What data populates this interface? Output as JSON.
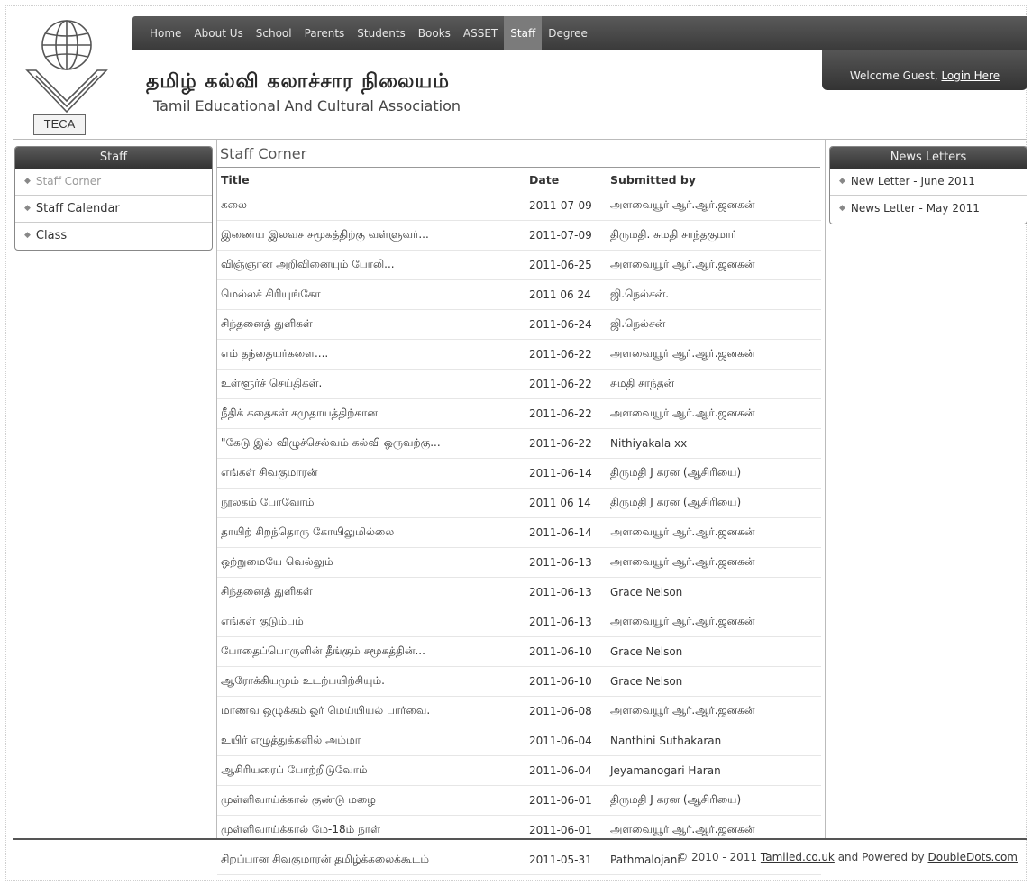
{
  "logo": {
    "text": "TECA",
    "icon": "globe-book-logo-icon"
  },
  "nav": {
    "items": [
      {
        "label": "Home"
      },
      {
        "label": "About Us"
      },
      {
        "label": "School"
      },
      {
        "label": "Parents"
      },
      {
        "label": "Students"
      },
      {
        "label": "Books"
      },
      {
        "label": "ASSET"
      },
      {
        "label": "Staff"
      },
      {
        "label": "Degree"
      }
    ],
    "active": "Staff"
  },
  "welcome": {
    "prefix": "Welcome Guest, ",
    "login": "Login Here"
  },
  "title_tamil": "தமிழ் கல்வி கலாச்சார நிலையம்",
  "title_english": "Tamil Educational And Cultural Association",
  "left_menu": {
    "title": "Staff",
    "items": [
      {
        "label": "Staff Corner"
      },
      {
        "label": "Staff Calendar"
      },
      {
        "label": "Class"
      }
    ]
  },
  "right_menu": {
    "title": "News Letters",
    "items": [
      {
        "label": "New Letter - June 2011"
      },
      {
        "label": "News Letter - May 2011"
      }
    ]
  },
  "content": {
    "heading": "Staff Corner",
    "columns": {
      "title": "Title",
      "date": "Date",
      "submitted": "Submitted by"
    },
    "rows": [
      {
        "title": "கலை",
        "date": "2011-07-09",
        "by": "அளவையூர் ஆர்.ஆர்.ஜனகன்"
      },
      {
        "title": "இணைய இலவச சமூகத்திற்கு வள்ளுவர்...",
        "date": "2011-07-09",
        "by": "திருமதி. சுமதி சாந்தகுமார்"
      },
      {
        "title": "விஞ்ஞான அறிவினையும் போலி...",
        "date": "2011-06-25",
        "by": "அளவையூர் ஆர்.ஆர்.ஜனகன்"
      },
      {
        "title": "மெல்லச் சிரியுங்கோ",
        "date": "2011 06 24",
        "by": "ஜி.நெல்சன்."
      },
      {
        "title": "சிந்தனைத் துளிகள்",
        "date": "2011-06-24",
        "by": "ஜி.நெல்சன்"
      },
      {
        "title": "எம் தந்தையர்களை....",
        "date": "2011-06-22",
        "by": "அளவையூர் ஆர்.ஆர்.ஜனகன்"
      },
      {
        "title": "உள்ளூர்ச் செய்திகள்.",
        "date": "2011-06-22",
        "by": "சுமதி சாந்தன்"
      },
      {
        "title": "நீதிக் கதைகள் சமுதாயத்திற்கான",
        "date": "2011-06-22",
        "by": "அளவையூர் ஆர்.ஆர்.ஜனகன்"
      },
      {
        "title": "\"கேடு இல் விழுச்செல்வம் கல்வி ஒருவற்கு...",
        "date": "2011-06-22",
        "by": "Nithiyakala xx"
      },
      {
        "title": "எங்கள் சிவகுமாரன்",
        "date": "2011-06-14",
        "by": "திருமதி J கரன (ஆசிரியை)"
      },
      {
        "title": "நூலகம் போவோம்",
        "date": "2011 06 14",
        "by": "திருமதி J கரன (ஆசிரியை)"
      },
      {
        "title": "தாயிற் சிறந்தொரு கோயிலுமில்லை",
        "date": "2011-06-14",
        "by": "அளவையூர் ஆர்.ஆர்.ஜனகன்"
      },
      {
        "title": "ஒற்றுமையே வெல்லும்",
        "date": "2011-06-13",
        "by": "அளவையூர் ஆர்.ஆர்.ஜனகன்"
      },
      {
        "title": "சிந்தனைத் துளிகள்",
        "date": "2011-06-13",
        "by": "Grace Nelson"
      },
      {
        "title": "எங்கள் குடும்பம்",
        "date": "2011-06-13",
        "by": "அளவையூர் ஆர்.ஆர்.ஜனகன்"
      },
      {
        "title": "போதைப்பொருளின் தீங்கும் சமூகத்தின்...",
        "date": "2011-06-10",
        "by": "Grace Nelson"
      },
      {
        "title": "ஆரோக்கியமும் உடற்பயிற்சியும்.",
        "date": "2011-06-10",
        "by": "Grace Nelson"
      },
      {
        "title": "மாணவ ஒழுக்கம் ஓர் மெய்யியல் பார்வை.",
        "date": "2011-06-08",
        "by": "அளவையூர் ஆர்.ஆர்.ஜனகன்"
      },
      {
        "title": "உயிர் எழுத்துக்களில் அம்மா",
        "date": "2011-06-04",
        "by": "Nanthini Suthakaran"
      },
      {
        "title": "ஆசிரியரைப் போற்றிடுவோம்",
        "date": "2011-06-04",
        "by": "Jeyamanogari Haran"
      },
      {
        "title": "முள்ளிவாய்க்கால் குண்டு மழை",
        "date": "2011-06-01",
        "by": "திருமதி J கரன (ஆசிரியை)"
      },
      {
        "title": "முள்ளிவாய்க்கால் மே-18ம் நாள்",
        "date": "2011-06-01",
        "by": "அளவையூர் ஆர்.ஆர்.ஜனகன்"
      },
      {
        "title": "சிறப்பான சிவகுமாரன் தமிழ்க்கலைக்கூடம்",
        "date": "2011-05-31",
        "by": "Pathmalojani"
      }
    ]
  },
  "footer": {
    "prefix": "© 2010 - 2011",
    "link1": "Tamiled.co.uk",
    "middle": "and Powered by",
    "link2": "DoubleDots.com"
  }
}
